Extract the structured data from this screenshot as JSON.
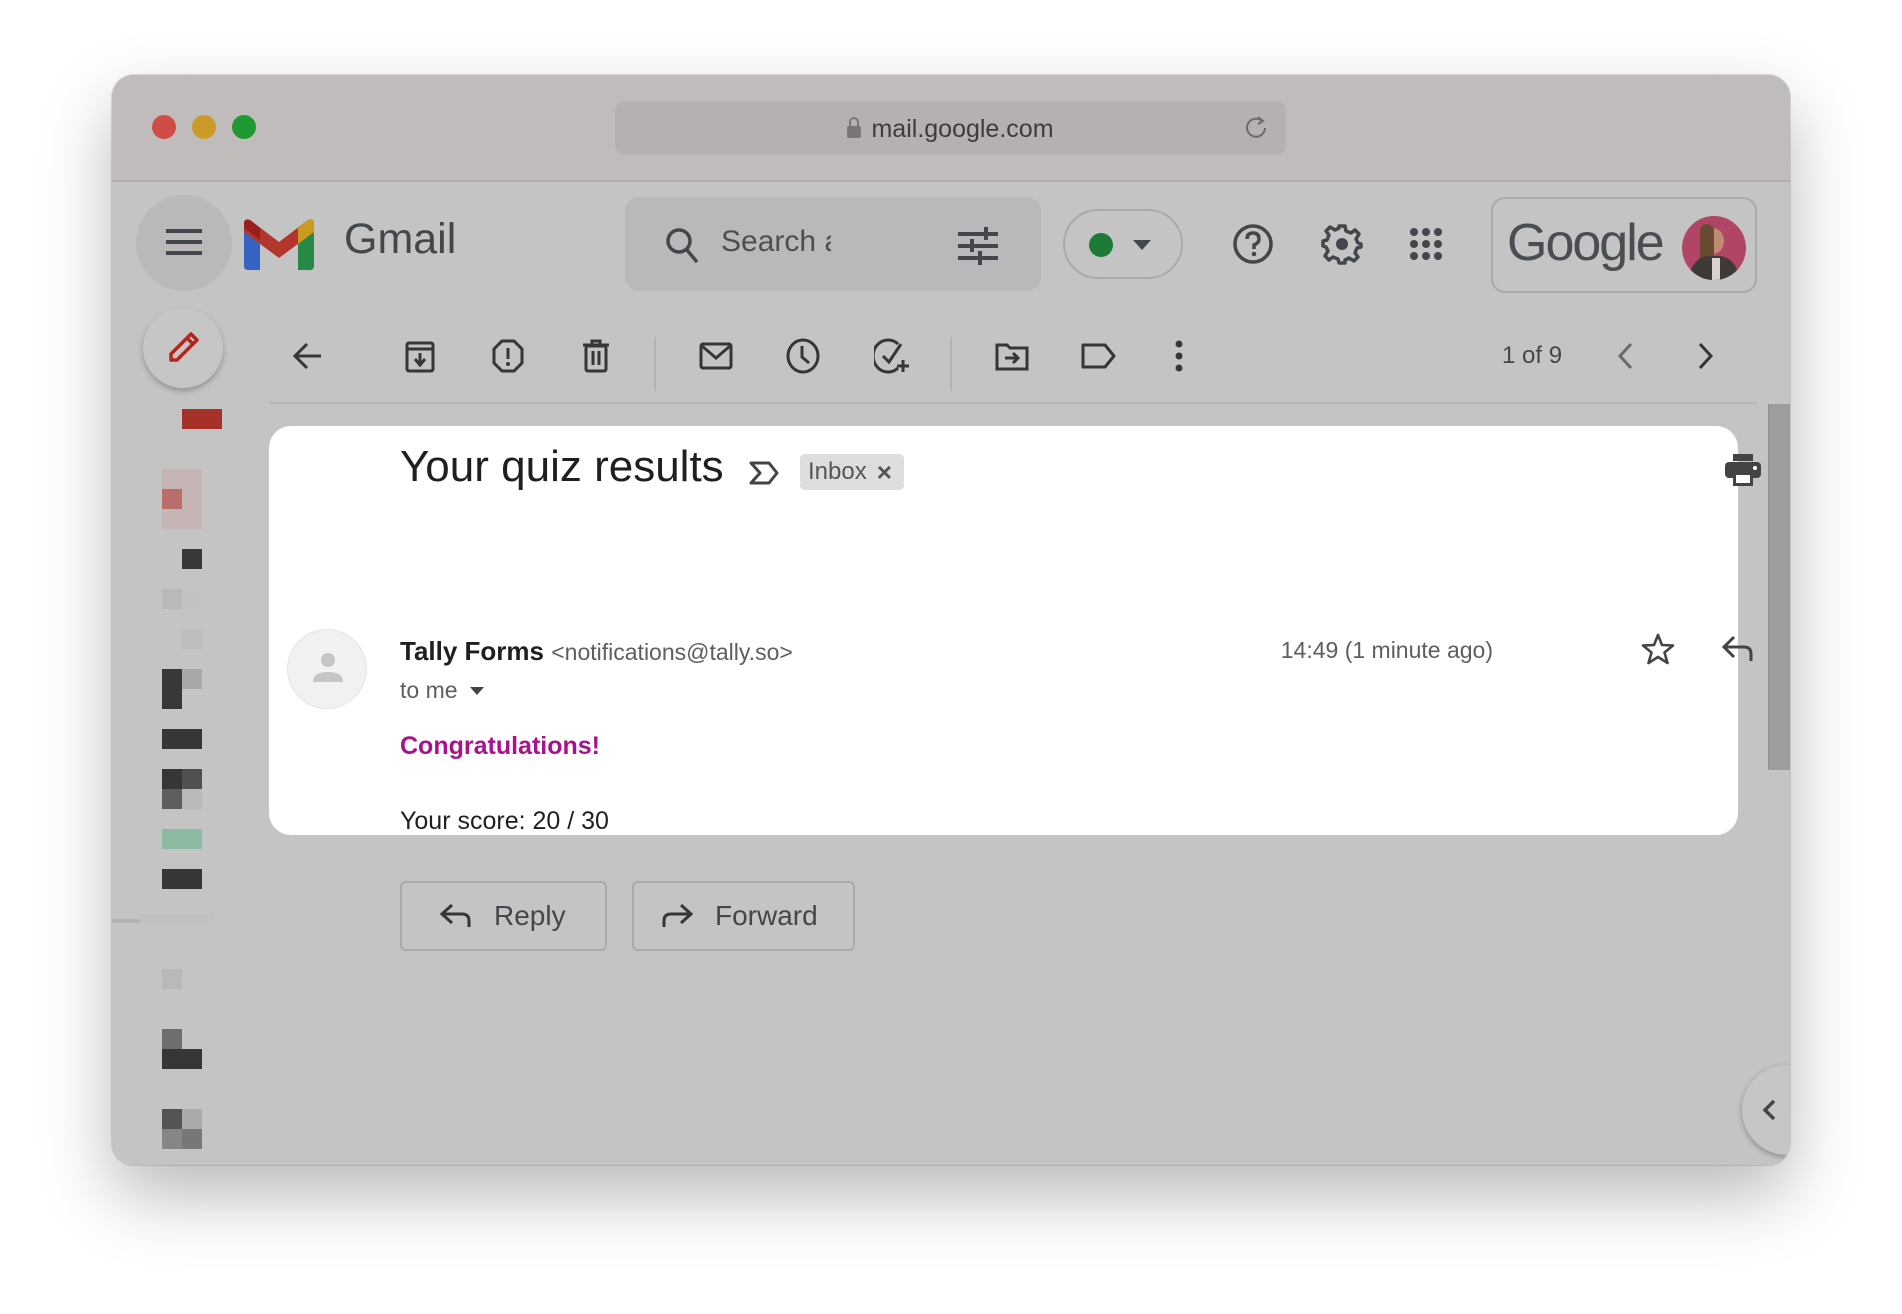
{
  "browser": {
    "url": "mail.google.com"
  },
  "header": {
    "app_name": "Gmail",
    "search_placeholder": "Search all conversations",
    "search_visible_text": "Search a",
    "status_color": "#1e7a37",
    "account_brand": "Google"
  },
  "toolbar": {
    "pagination": "1 of 9",
    "actions": [
      "Back",
      "Archive",
      "Report spam",
      "Delete",
      "Mark as unread",
      "Snooze",
      "Add to Tasks",
      "Move to",
      "Labels",
      "More"
    ]
  },
  "email": {
    "subject": "Your quiz results",
    "label_chip": "Inbox",
    "label_chip_remove": "×",
    "sender_name": "Tally Forms",
    "sender_email": "<notifications@tally.so>",
    "recipient": "to me",
    "time": "14:49 (1 minute ago)",
    "body_heading": "Congratulations!",
    "body_heading_color": "#a8128c",
    "body_text": "Your score: 20 / 30"
  },
  "footer_actions": {
    "reply": "Reply",
    "forward": "Forward"
  },
  "colors": {
    "gmail_red": "#b3362d",
    "compose_pencil": "#b3261e"
  }
}
